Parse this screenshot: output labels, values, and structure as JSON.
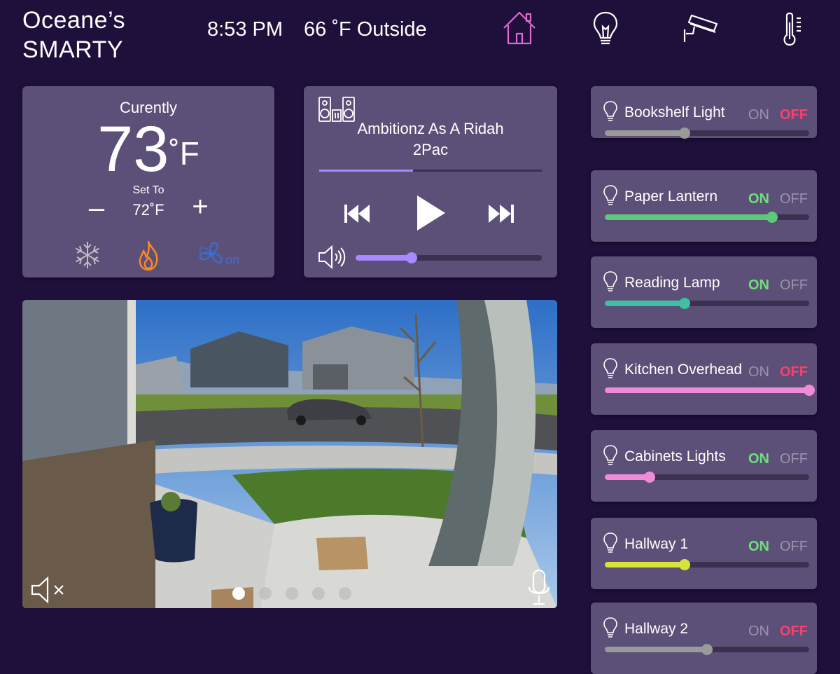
{
  "header": {
    "title_line1": "Oceane’s",
    "title_line2": "SMARTY",
    "time": "8:53 PM",
    "weather": "66 ˚F Outside",
    "nav": [
      {
        "icon": "home-icon",
        "active": true
      },
      {
        "icon": "lightbulb-icon",
        "active": false
      },
      {
        "icon": "security-camera-icon",
        "active": false
      },
      {
        "icon": "thermometer-icon",
        "active": false
      }
    ]
  },
  "thermostat": {
    "current_label": "Curently",
    "current_temp": "73",
    "current_unit": "˚F",
    "set_label": "Set To",
    "set_temp": "72˚F",
    "minus_label": "–",
    "plus_label": "+",
    "fan_label": "on",
    "modes": [
      "snowflake-icon",
      "flame-icon",
      "fan-icon"
    ]
  },
  "music": {
    "song": "Ambitionz As A Ridah",
    "artist": "2Pac",
    "progress": 0.42,
    "volume": 0.3
  },
  "camera": {
    "dots": 5,
    "active_dot": 0
  },
  "lights": [
    {
      "name": "Bookshelf Light",
      "on_label": "ON",
      "off_label": "OFF",
      "state": "off",
      "level": 0.39,
      "color": "#9a9a9a"
    },
    {
      "name": "Paper Lantern",
      "on_label": "ON",
      "off_label": "OFF",
      "state": "on",
      "level": 0.82,
      "color": "#5ec97a"
    },
    {
      "name": "Reading Lamp",
      "on_label": "ON",
      "off_label": "OFF",
      "state": "on",
      "level": 0.39,
      "color": "#3fc0a0"
    },
    {
      "name": "Kitchen Overhead",
      "on_label": "ON",
      "off_label": "OFF",
      "state": "off",
      "level": 1.0,
      "color": "#f08bd8"
    },
    {
      "name": "Cabinets Lights",
      "on_label": "ON",
      "off_label": "OFF",
      "state": "on",
      "level": 0.22,
      "color": "#f08bd8"
    },
    {
      "name": "Hallway 1",
      "on_label": "ON",
      "off_label": "OFF",
      "state": "on",
      "level": 0.39,
      "color": "#d7e23a"
    },
    {
      "name": "Hallway 2",
      "on_label": "ON",
      "off_label": "OFF",
      "state": "off",
      "level": 0.5,
      "color": "#9a9a9a"
    }
  ],
  "colors": {
    "background": "#1e0f3b",
    "card": "#5c5078",
    "accent": "#a889ff",
    "on_active": "#6ee07a",
    "off_active": "#ff3d6e",
    "inactive_label": "#9b92ae",
    "home_icon": "#e06ad0",
    "flame": "#ff8a1f",
    "fan": "#3a6ed0"
  }
}
